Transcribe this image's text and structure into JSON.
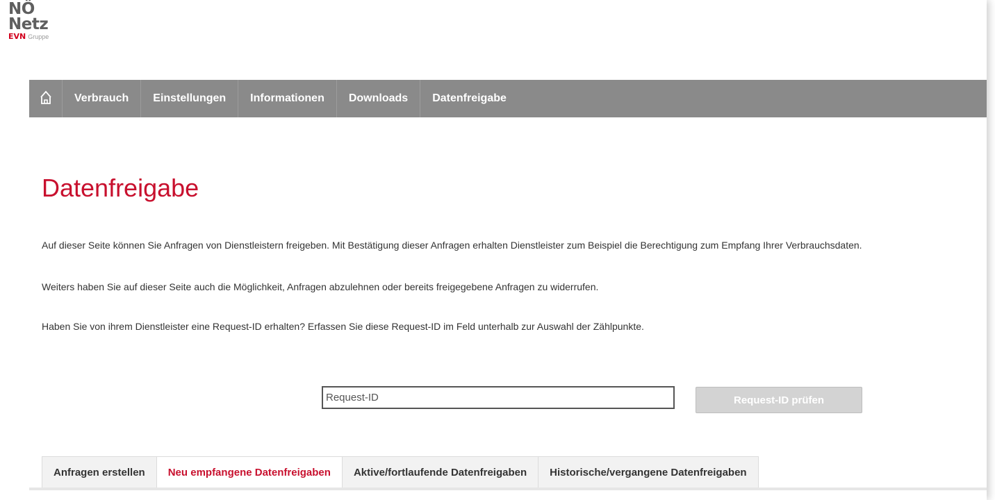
{
  "logo": {
    "line1": "NÖ",
    "line2": "Netz",
    "brand": "EVN",
    "group": "Gruppe"
  },
  "nav": {
    "home_icon": "home-icon",
    "items": [
      {
        "label": "Verbrauch"
      },
      {
        "label": "Einstellungen"
      },
      {
        "label": "Informationen"
      },
      {
        "label": "Downloads"
      },
      {
        "label": "Datenfreigabe"
      }
    ]
  },
  "main": {
    "title": "Datenfreigabe",
    "paragraphs": [
      "Auf dieser Seite können Sie Anfragen von Dienstleistern freigeben. Mit Bestätigung dieser Anfragen erhalten Dienstleister zum Beispiel die Berechtigung zum Empfang Ihrer Verbrauchsdaten.",
      "Weiters haben Sie auf dieser Seite auch die Möglichkeit, Anfragen abzulehnen oder bereits freigegebene Anfragen zu widerrufen.",
      "Haben Sie von ihrem Dienstleister eine Request-ID erhalten? Erfassen Sie diese Request-ID im Feld unterhalb zur Auswahl der Zählpunkte."
    ],
    "request": {
      "placeholder": "Request-ID",
      "value": "",
      "button_label": "Request-ID prüfen"
    },
    "tabs": [
      {
        "label": "Anfragen erstellen",
        "active": false
      },
      {
        "label": "Neu empfangene Datenfreigaben",
        "active": true
      },
      {
        "label": "Aktive/fortlaufende Datenfreigaben",
        "active": false
      },
      {
        "label": "Historische/vergangene Datenfreigaben",
        "active": false
      }
    ]
  },
  "colors": {
    "accent": "#c8102e",
    "nav_bg": "#8a8a8a",
    "button_disabled": "#d3d3d3"
  }
}
